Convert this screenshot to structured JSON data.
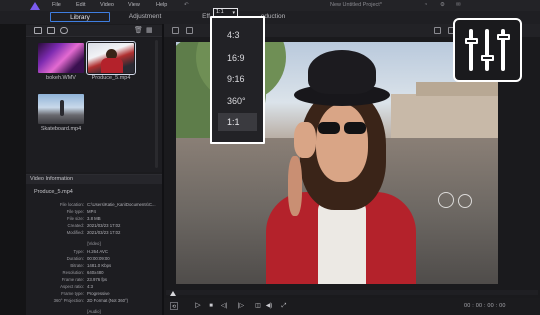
{
  "app": {
    "project_title": "New Untitled Project*",
    "menu": [
      "File",
      "Edit",
      "Video",
      "View",
      "Help"
    ],
    "brand_color": "#7b5cf0"
  },
  "tabs": [
    {
      "label": "Library",
      "active": true
    },
    {
      "label": "Adjustment",
      "active": false
    },
    {
      "label": "Eff",
      "active": false
    },
    {
      "label": "oduction",
      "active": false
    }
  ],
  "library": {
    "items": [
      {
        "label": "bokeh.WMV",
        "selected": false
      },
      {
        "label": "Produce_5.mp4",
        "selected": true
      },
      {
        "label": "Skateboard.mp4",
        "selected": false
      }
    ]
  },
  "video_info": {
    "header": "Video Information",
    "file_name": "Produce_5.mp4",
    "general": [
      {
        "k": "File location:",
        "v": "C:\\Users\\Katie_Kan\\Documents\\C..."
      },
      {
        "k": "File type:",
        "v": "MP4"
      },
      {
        "k": "File size:",
        "v": "3.8 MB"
      },
      {
        "k": "Created:",
        "v": "2021/03/23 17:02"
      },
      {
        "k": "Modified:",
        "v": "2021/03/23 17:02"
      }
    ],
    "video_group": "[Video]",
    "video": [
      {
        "k": "Type:",
        "v": "H.264 AVC"
      },
      {
        "k": "Duration:",
        "v": "00:00:09:00"
      },
      {
        "k": "Bitrate:",
        "v": "1481.0 Kbps"
      },
      {
        "k": "Resolution:",
        "v": "640x480"
      },
      {
        "k": "Frame rate:",
        "v": "23.976 fps"
      },
      {
        "k": "Aspect ratio:",
        "v": "4:3"
      },
      {
        "k": "Frame type:",
        "v": "Progressive"
      },
      {
        "k": "360° Projection:",
        "v": "2D Format (Not 360°)"
      }
    ],
    "audio_group": "[Audio]"
  },
  "aspect_ratio": {
    "current": "1:1",
    "options": [
      {
        "label": "4:3",
        "selected": false
      },
      {
        "label": "16:9",
        "selected": false
      },
      {
        "label": "9:16",
        "selected": false
      },
      {
        "label": "360°",
        "selected": false
      },
      {
        "label": "1:1",
        "selected": true
      }
    ]
  },
  "player": {
    "timecode": "00 : 00 : 00 : 00",
    "controls": [
      "play-icon",
      "stop-icon",
      "prev-frame-icon",
      "next-frame-icon",
      "volume-icon"
    ]
  },
  "adjustment_icon": "sliders-icon"
}
